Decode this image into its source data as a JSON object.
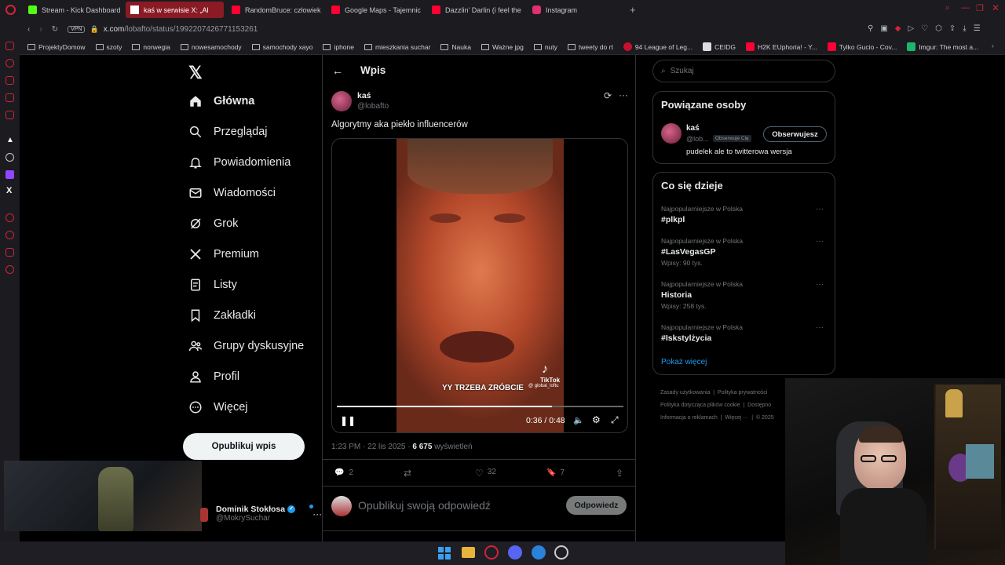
{
  "browser": {
    "tabs": [
      {
        "label": "Stream - Kick Dashboard",
        "color": "#53fc18"
      },
      {
        "label": "kaś w serwisie X: „Al",
        "color": "#ffffff"
      },
      {
        "label": "RandomBruce: człowiek",
        "color": "#ff0033"
      },
      {
        "label": "Google Maps - Tajemnic",
        "color": "#ff0033"
      },
      {
        "label": "Dazzlin' Darlin (i feel the",
        "color": "#ff0033"
      },
      {
        "label": "Instagram",
        "color": "#e1306c"
      }
    ],
    "vpn": "VPN",
    "url_host": "x.com",
    "url_path": "/lobafto/status/1992207426771153261",
    "bookmarks": [
      "ProjektyDomow",
      "szoty",
      "norwegia",
      "nowesamochody",
      "samochody xayo",
      "iphone",
      "mieszkania suchar",
      "Nauka",
      "Ważne jpg",
      "nuty",
      "tweety do rt",
      "94 League of Leg...",
      "CEIDG",
      "H2K EUphoria! - Y...",
      "Tylko Gucio - Cov...",
      "Imgur: The most a..."
    ]
  },
  "nav": {
    "items": [
      "Główna",
      "Przeglądaj",
      "Powiadomienia",
      "Wiadomości",
      "Grok",
      "Premium",
      "Listy",
      "Zakładki",
      "Grupy dyskusyjne",
      "Profil",
      "Więcej"
    ],
    "post_button": "Opublikuj wpis",
    "account_name": "Dominik Stokłosa",
    "account_handle": "@MokrySuchar"
  },
  "post": {
    "header": "Wpis",
    "author": "kaś",
    "handle": "@lobafto",
    "text": "Algorytmy aka piekło influencerów",
    "caption": "YY TRZEBA ZRÓBCIE",
    "watermark": "TikTok",
    "watermark_handle": "@ global_loftu",
    "time": "0:36 / 0:48",
    "progress": 0.75,
    "meta_time": "1:23 PM · 22 lis 2025 · ",
    "views": "6 675",
    "views_label": " wyświetleń",
    "replies": "2",
    "reposts": "",
    "likes": "32",
    "bookmarks": "7",
    "reply_placeholder": "Opublikuj swoją odpowiedź",
    "reply_button": "Odpowiedz"
  },
  "right": {
    "search_placeholder": "Szukaj",
    "related_title": "Powiązane osoby",
    "related_name": "kaś",
    "related_handle": "@lob...",
    "follows_you": "Obserwuje Cię",
    "follow_button": "Obserwujesz",
    "related_bio": "pudelek ale to twitterowa wersja",
    "trends_title": "Co się dzieje",
    "trends": [
      {
        "meta": "Najpopularniejsze w Polska",
        "tag": "#plkpl",
        "count": ""
      },
      {
        "meta": "Najpopularniejsze w Polska",
        "tag": "#LasVegasGP",
        "count": "Wpisy: 90 tys."
      },
      {
        "meta": "Najpopularniejsze w Polska",
        "tag": "Historia",
        "count": "Wpisy: 258 tys."
      },
      {
        "meta": "Najpopularniejsze w Polska",
        "tag": "#Iskstylżycia",
        "count": ""
      }
    ],
    "show_more": "Pokaż więcej",
    "footer": [
      "Zasady użytkowania",
      "Polityka prywatności",
      "Polityka dotycząca plików cookie",
      "Dostępno",
      "Informacja o reklamach",
      "Więcej ···",
      "© 2025"
    ]
  }
}
